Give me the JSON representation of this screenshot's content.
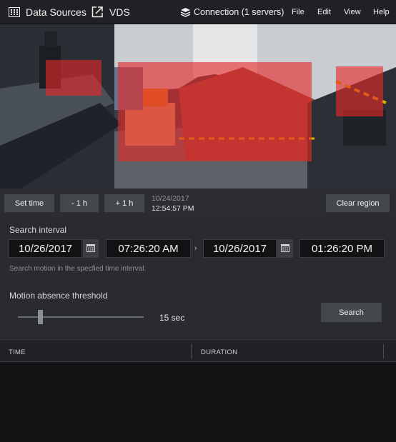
{
  "menubar": {
    "data_sources": {
      "label": "Data Sources",
      "icon": "grid-icon"
    },
    "vds": {
      "label": "VDS",
      "icon": "external-link-icon"
    },
    "connection": {
      "label": "Connection (1 servers)",
      "icon": "server-stack-icon"
    },
    "file": "File",
    "edit": "Edit",
    "view": "View",
    "help": "Help"
  },
  "video": {
    "motion_regions": 3,
    "region_color": "#e62828"
  },
  "controls": {
    "set_time": "Set time",
    "minus_hour": "- 1 h",
    "plus_hour": "+ 1 h",
    "frame_date": "10/24/2017",
    "frame_time": "12:54:57 PM",
    "clear_region": "Clear region"
  },
  "search": {
    "interval_label": "Search interval",
    "start_date": "10/26/2017",
    "start_time": "07:26:20 AM",
    "separator": "›",
    "end_date": "10/26/2017",
    "end_time": "01:26:20 PM",
    "hint": "Search motion in the specfied time interval.",
    "threshold_label": "Motion absence threshold",
    "threshold_value": "15 sec",
    "threshold_fraction": 0.18,
    "search_button": "Search"
  },
  "results": {
    "columns": [
      "TIME",
      "DURATION"
    ],
    "rows": []
  }
}
